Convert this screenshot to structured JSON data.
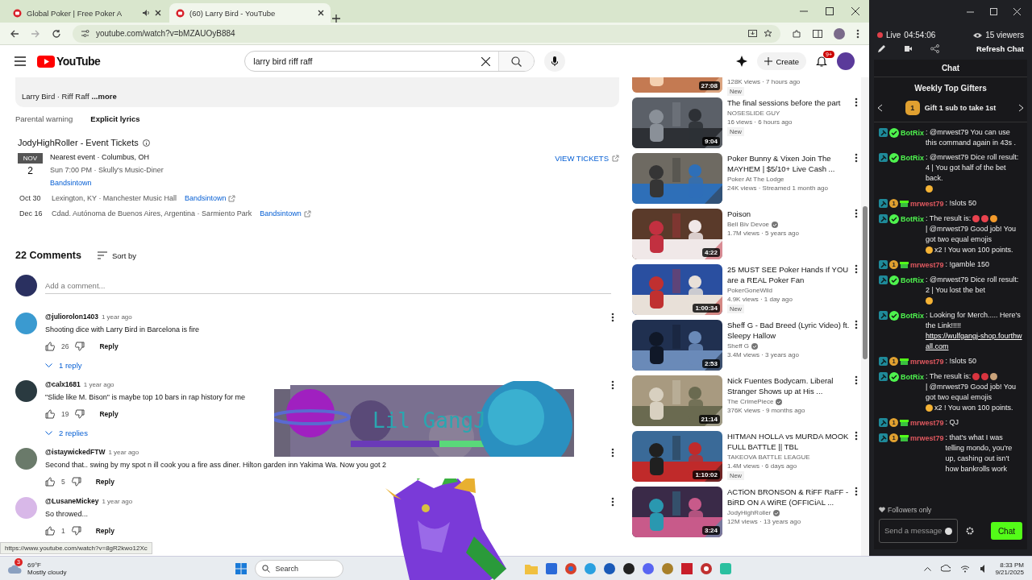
{
  "browser": {
    "tabs": [
      {
        "title": "Global Poker | Free Poker A",
        "selected": false,
        "audio": true
      },
      {
        "title": "(60) Larry Bird - YouTube",
        "selected": true,
        "audio": false
      }
    ],
    "url": "youtube.com/watch?v=bMZAUOyB884",
    "status_url": "https://www.youtube.com/watch?v=8gR2kwo12Xc"
  },
  "youtube": {
    "logo": "YouTube",
    "search": "larry bird riff raff",
    "create": "Create",
    "notifications": "9+"
  },
  "description": {
    "text": "Larry Bird · Riff Raff",
    "more": "...more",
    "warning_label": "Parental warning",
    "warning": "Explicit lyrics"
  },
  "tickets": {
    "title": "JodyHighRoller - Event Tickets",
    "month": "NOV",
    "day": "2",
    "line1": "Nearest event · Columbus, OH",
    "line2": "Sun 7:00 PM · Skully's Music-Diner",
    "link": "Bandsintown",
    "view": "VIEW TICKETS",
    "events": [
      {
        "date": "Oct 30",
        "place": "Lexington, KY · Manchester Music Hall",
        "link": "Bandsintown"
      },
      {
        "date": "Dec 16",
        "place": "Cdad. Autónoma de Buenos Aires, Argentina · Sarmiento Park",
        "link": "Bandsintown"
      }
    ]
  },
  "comments": {
    "count": "22 Comments",
    "sort": "Sort by",
    "placeholder": "Add a comment...",
    "items": [
      {
        "author": "@juliorolon1403",
        "time": "1 year ago",
        "text": "Shooting dice with Larry Bird in Barcelona is fire",
        "likes": "26",
        "reply": "Reply",
        "replies": "1 reply"
      },
      {
        "author": "@calx1681",
        "time": "1 year ago",
        "text": "\"Slide like M. Bison\" is maybe top 10 bars in rap history for me",
        "likes": "19",
        "reply": "Reply",
        "replies": "2 replies"
      },
      {
        "author": "@istaywickedFTW",
        "time": "1 year ago",
        "text": "Second that.. swing by my spot n ill cook you a fire ass diner. Hilton garden inn Yakima Wa. Now you got 2",
        "likes": "5",
        "reply": "Reply"
      },
      {
        "author": "@LusaneMickey",
        "time": "1 year ago",
        "text": "So throwed...",
        "likes": "1",
        "reply": "Reply"
      }
    ]
  },
  "videos": [
    {
      "meta": "128K views · 7 hours ago",
      "new": "New",
      "duration": "27:08"
    },
    {
      "title": "The final sessions before the part",
      "channel": "NOSESLIDE GUY",
      "verified": false,
      "meta": "16 views · 6 hours ago",
      "new": "New",
      "duration": "9:04"
    },
    {
      "title": "Poker Bunny & Vixen Join The MAYHEM | $5/10+ Live Cash ...",
      "channel": "Poker At The Lodge",
      "verified": false,
      "meta": "24K views · Streamed 1 month ago"
    },
    {
      "title": "Poison",
      "channel": "Bell Biv Devoe",
      "verified": true,
      "meta": "1.7M views · 5 years ago",
      "duration": "4:22"
    },
    {
      "title": "25 MUST SEE Poker Hands If YOU are a REAL Poker Fan",
      "channel": "PokerGoneWild",
      "verified": false,
      "meta": "4.9K views · 1 day ago",
      "new": "New",
      "duration": "1:00:34"
    },
    {
      "title": "Sheff G - Bad Breed (Lyric Video) ft. Sleepy Hallow",
      "channel": "Sheff G",
      "verified": true,
      "meta": "3.4M views · 3 years ago",
      "duration": "2:53"
    },
    {
      "title": "Nick Fuentes Bodycam. Liberal Stranger Shows up at His ...",
      "channel": "The CrimePiece",
      "verified": true,
      "meta": "376K views · 9 months ago",
      "duration": "21:14"
    },
    {
      "title": "HITMAN HOLLA vs MURDA MOOK FULL BATTLE || TBL",
      "channel": "TAKEOVA BATTLE LEAGUE",
      "verified": false,
      "meta": "1.4M views · 6 days ago",
      "new": "New",
      "duration": "1:10:02"
    },
    {
      "title": "ACTiON BRONSON & RiFF RaFF - BiRD ON A WiRE (OFFICiAL ...",
      "channel": "JodyHighRoller",
      "verified": true,
      "meta": "12M views · 13 years ago",
      "duration": "3:24"
    }
  ],
  "overlay": {
    "title": "Lil GangJ"
  },
  "chat": {
    "live": "Live",
    "uptime": "04:54:06",
    "viewers": "15 viewers",
    "refresh": "Refresh Chat",
    "title": "Chat",
    "gifters_title": "Weekly Top Gifters",
    "gifter_badge": "1",
    "gifters_text": "Gift 1 sub to take 1st",
    "messages": [
      {
        "kind": "bot",
        "user": "BotRix",
        "color": "#4ef34e",
        "parts": [
          {
            "kind": "text",
            "text": ": @mrwest79 You can use this command again in 43s ."
          }
        ]
      },
      {
        "kind": "bot",
        "user": "BotRix",
        "color": "#4ef34e",
        "parts": [
          {
            "kind": "text",
            "text": ": @mrwest79 Dice roll result: 4 | You got half of the bet back."
          },
          {
            "kind": "emoji",
            "color": "#f5b335"
          }
        ]
      },
      {
        "kind": "user",
        "user": "mrwest79",
        "color": "#e0585f",
        "badge": "1",
        "parts": [
          {
            "kind": "text",
            "text": ": !slots 50"
          }
        ]
      },
      {
        "kind": "bot",
        "user": "BotRix",
        "color": "#4ef34e",
        "parts": [
          {
            "kind": "text",
            "text": ": The result is:"
          },
          {
            "kind": "emoji",
            "color": "#e8424e"
          },
          {
            "kind": "emoji",
            "color": "#e8424e"
          },
          {
            "kind": "emoji",
            "color": "#f39a2b"
          },
          {
            "kind": "text",
            "text": "| @mrwest79 Good job! You got two equal emojis"
          },
          {
            "kind": "emoji",
            "color": "#f5b335"
          },
          {
            "kind": "text",
            "text": "x2 ! You won 100 points."
          }
        ]
      },
      {
        "kind": "user",
        "user": "mrwest79",
        "color": "#e0585f",
        "badge": "1",
        "parts": [
          {
            "kind": "text",
            "text": ": !gamble 150"
          }
        ]
      },
      {
        "kind": "bot",
        "user": "BotRix",
        "color": "#4ef34e",
        "parts": [
          {
            "kind": "text",
            "text": ": @mrwest79 Dice roll result: 2 | You lost the bet"
          },
          {
            "kind": "emoji",
            "color": "#f5b335"
          }
        ]
      },
      {
        "kind": "bot",
        "user": "BotRix",
        "color": "#4ef34e",
        "parts": [
          {
            "kind": "text",
            "text": ": Looking for Merch..... Here's the Link!!!!!"
          },
          {
            "kind": "link",
            "text": "https://wulfgangj-shop.fourthwall.com"
          }
        ]
      },
      {
        "kind": "user",
        "user": "mrwest79",
        "color": "#e0585f",
        "badge": "1",
        "parts": [
          {
            "kind": "text",
            "text": ": !slots 50"
          }
        ]
      },
      {
        "kind": "bot",
        "user": "BotRix",
        "color": "#4ef34e",
        "parts": [
          {
            "kind": "text",
            "text": ": The result is:"
          },
          {
            "kind": "emoji",
            "color": "#d8343f"
          },
          {
            "kind": "emoji",
            "color": "#d8343f"
          },
          {
            "kind": "emoji",
            "color": "#c9a27a"
          },
          {
            "kind": "text",
            "text": "| @mrwest79 Good job! You got two equal emojis"
          },
          {
            "kind": "emoji",
            "color": "#f5b335"
          },
          {
            "kind": "text",
            "text": "x2 ! You won 100 points."
          }
        ]
      },
      {
        "kind": "user",
        "user": "mrwest79",
        "color": "#e0585f",
        "badge": "1",
        "parts": [
          {
            "kind": "text",
            "text": ": QJ"
          }
        ]
      },
      {
        "kind": "user",
        "user": "mrwest79",
        "color": "#e0585f",
        "badge": "1",
        "parts": [
          {
            "kind": "text",
            "text": ": that's what I was telling mondo, you're up, cashing out isn't how bankrolls work"
          }
        ]
      }
    ],
    "mode": "Followers only",
    "placeholder": "Send a message",
    "send": "Chat"
  },
  "taskbar": {
    "temperature": "69°F",
    "weather": "Mostly cloudy",
    "weather_badge": "3",
    "search": "Search",
    "time": "8:33 PM",
    "date": "9/21/2025"
  }
}
